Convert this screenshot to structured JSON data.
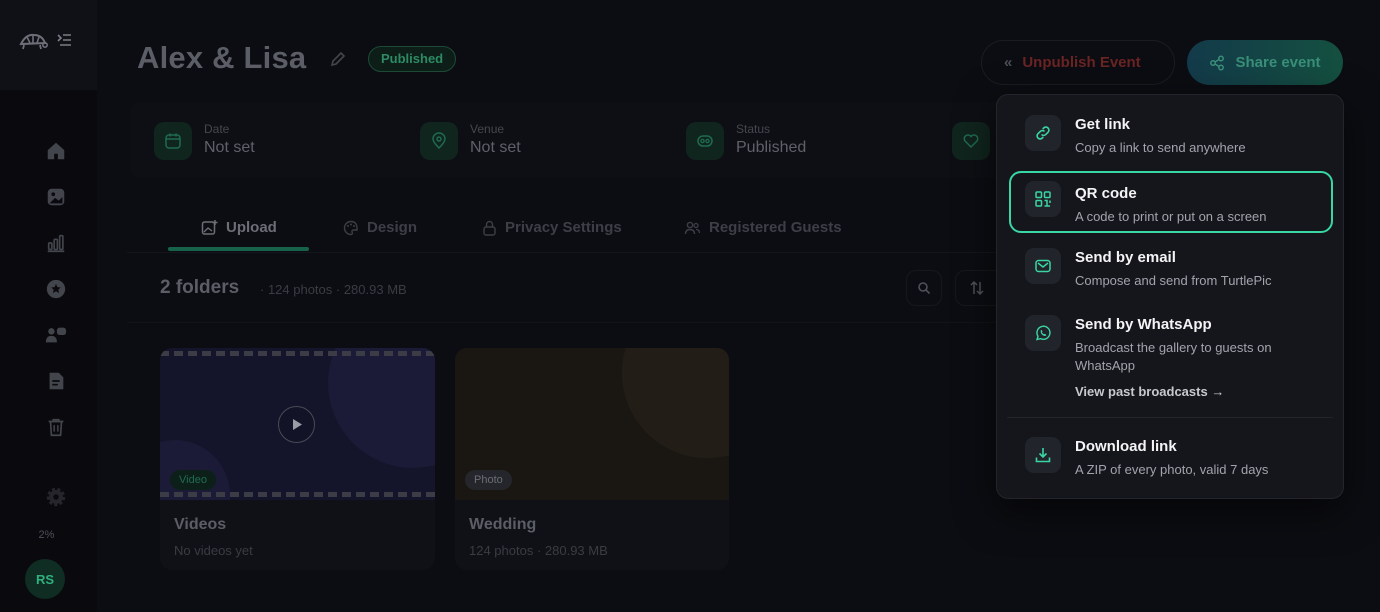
{
  "header": {
    "event_title": "Alex & Lisa",
    "status_badge": "Published",
    "unpublish_label": "Unpublish Event",
    "share_label": "Share event"
  },
  "info": [
    {
      "label": "Date",
      "value": "Not set",
      "icon": "calendar-icon"
    },
    {
      "label": "Venue",
      "value": "Not set",
      "icon": "map-pin-icon"
    },
    {
      "label": "Status",
      "value": "Published",
      "icon": "status-icon"
    },
    {
      "label": "",
      "value": "",
      "icon": "heart-icon"
    }
  ],
  "tabs": [
    {
      "label": "Upload",
      "icon": "upload-image-icon",
      "active": true
    },
    {
      "label": "Design",
      "icon": "palette-icon"
    },
    {
      "label": "Privacy Settings",
      "icon": "lock-icon"
    },
    {
      "label": "Registered Guests",
      "icon": "users-icon"
    }
  ],
  "folders": {
    "title": "2 folders",
    "meta": "· 124 photos · 280.93 MB",
    "items": [
      {
        "name": "Videos",
        "sub": "No videos yet",
        "tag": "Video"
      },
      {
        "name": "Wedding",
        "sub": "124 photos · 280.93 MB",
        "tag": "Photo"
      }
    ]
  },
  "sidebar": {
    "usage": "2%",
    "avatar_initials": "RS"
  },
  "share_menu": {
    "items": [
      {
        "title": "Get link",
        "desc": "Copy a link to send anywhere",
        "icon": "link-icon"
      },
      {
        "title": "QR code",
        "desc": "A code to print or put on a screen",
        "icon": "qr-code-icon",
        "selected": true
      },
      {
        "title": "Send by email",
        "desc": "Compose and send from TurtlePic",
        "icon": "mail-icon"
      },
      {
        "title": "Send by WhatsApp",
        "desc": "Broadcast the gallery to guests on WhatsApp",
        "link": "View past broadcasts →",
        "icon": "whatsapp-icon"
      },
      {
        "title": "Download link",
        "desc": "A ZIP of every photo, valid 7 days",
        "icon": "download-icon"
      }
    ]
  },
  "colors": {
    "accent": "#39d6a3",
    "danger_dim": "#6b2424",
    "background": "#0c0d12",
    "menu_bg": "#15161b"
  }
}
